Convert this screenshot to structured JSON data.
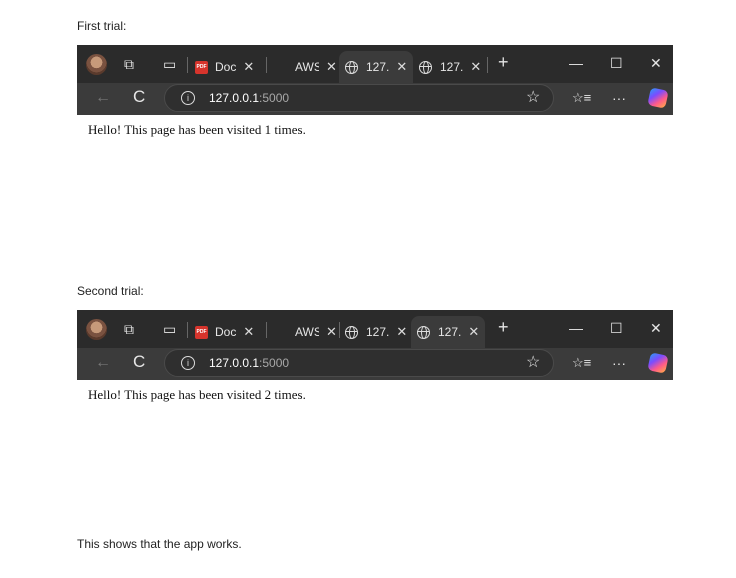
{
  "captions": {
    "first": "First trial:",
    "second": "Second trial:",
    "footer": "This shows that the app works."
  },
  "screenshots": [
    {
      "tabs": [
        {
          "label": "Doc",
          "icon": "pdf-icon",
          "active": false
        },
        {
          "label": "AWS",
          "icon": "aws-icon",
          "active": false
        },
        {
          "label": "127.",
          "icon": "globe-icon",
          "active": true
        },
        {
          "label": "127.",
          "icon": "globe-icon",
          "active": false
        }
      ],
      "url_host": "127.0.0.1",
      "url_port": ":5000",
      "page_text": "Hello! This page has been visited 1 times."
    },
    {
      "tabs": [
        {
          "label": "Doc",
          "icon": "pdf-icon",
          "active": false
        },
        {
          "label": "AWS",
          "icon": "aws-icon",
          "active": false
        },
        {
          "label": "127.",
          "icon": "globe-icon",
          "active": false
        },
        {
          "label": "127.",
          "icon": "globe-icon",
          "active": true
        }
      ],
      "url_host": "127.0.0.1",
      "url_port": ":5000",
      "page_text": "Hello! This page has been visited 2 times."
    }
  ],
  "glyphs": {
    "close": "✕",
    "new_tab": "+",
    "minimize": "—",
    "maximize": "☐",
    "back": "←",
    "refresh": "C",
    "star": "☆",
    "favorites": "☆≡",
    "more": "···",
    "info": "i",
    "pdf_badge": "PDF"
  },
  "colors": {
    "titlebar": "#2b2b2b",
    "addressbar": "#3b3b3b",
    "active_tab": "#3b3b3b",
    "text_light": "#e6e6e6"
  }
}
